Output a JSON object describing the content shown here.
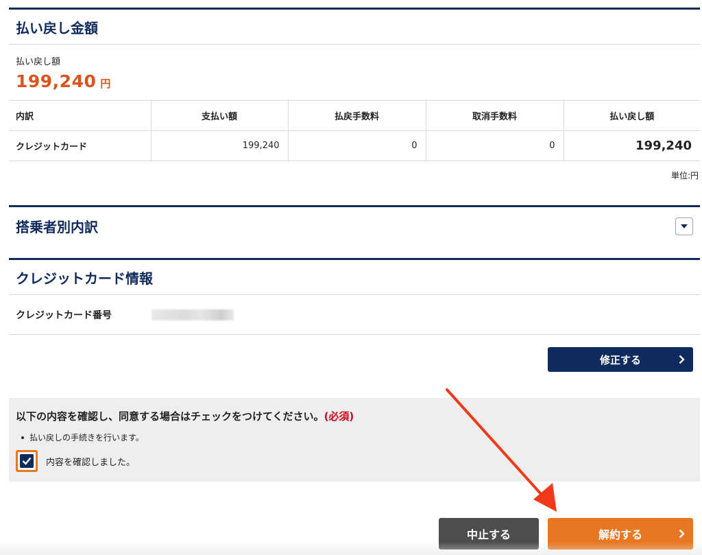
{
  "refund_section": {
    "title": "払い戻し金額",
    "amount_label": "払い戻し額",
    "amount_value": "199,240",
    "amount_unit": "円",
    "table": {
      "headers": [
        "内訳",
        "支払い額",
        "払戻手数料",
        "取消手数料",
        "払い戻し額"
      ],
      "rows": [
        [
          "クレジットカード",
          "199,240",
          "0",
          "0",
          "199,240"
        ]
      ]
    },
    "unit_note": "単位:円"
  },
  "passengers_section": {
    "title": "搭乗者別内訳",
    "toggle_icon": "chevron-down-icon"
  },
  "card_section": {
    "title": "クレジットカード情報",
    "number_label": "クレジットカード番号",
    "number_value_redacted": true
  },
  "edit_button": {
    "label": "修正する"
  },
  "consent": {
    "title": "以下の内容を確認し、同意する場合はチェックをつけてください。",
    "required_label": "(必須)",
    "bullet": "払い戻しの手続きを行います。",
    "checkbox_label": "内容を確認しました。",
    "checked": true
  },
  "actions": {
    "cancel_label": "中止する",
    "submit_label": "解約する"
  },
  "colors": {
    "navy": "#0f2a5c",
    "orange": "#e87722",
    "amount_orange": "#d9541e",
    "required_red": "#d0021b",
    "annotation_red": "#f03a17",
    "gray_button": "#4d4d4d"
  }
}
